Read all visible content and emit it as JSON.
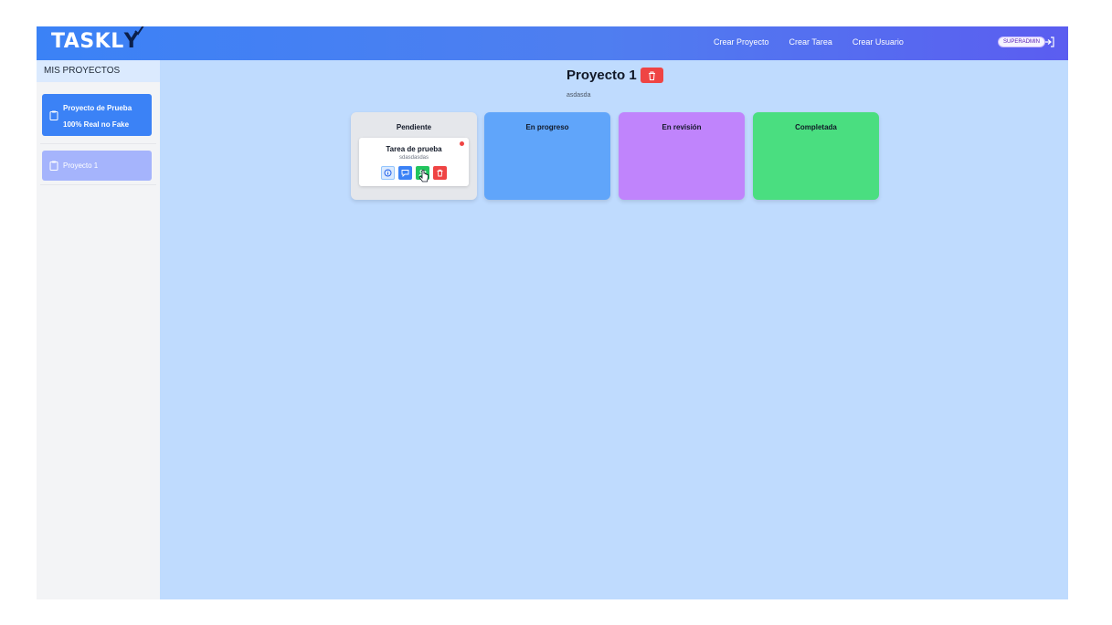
{
  "header": {
    "logo": "TASKL",
    "logo_last": "Y",
    "nav": [
      "Crear Proyecto",
      "Crear Tarea",
      "Crear Usuario"
    ],
    "role_badge": "SUPERADMIN",
    "logout_icon": "logout-icon"
  },
  "sidebar": {
    "title": "MIS PROYECTOS",
    "projects": [
      {
        "label_line1": "Proyecto de Prueba",
        "label_line2": "100% Real no Fake",
        "icon": "clipboard-icon",
        "active": true
      },
      {
        "label_line1": "Proyecto 1",
        "label_line2": "",
        "icon": "clipboard-icon",
        "active": false
      }
    ]
  },
  "main": {
    "title": "Proyecto 1",
    "description": "asdasda",
    "delete_icon": "trash-icon",
    "columns": [
      {
        "title": "Pendiente",
        "color": "#e5e7eb"
      },
      {
        "title": "En progreso",
        "color": "#60a5fa"
      },
      {
        "title": "En revisión",
        "color": "#c084fc"
      },
      {
        "title": "Completada",
        "color": "#4ade80"
      }
    ],
    "tasks": [
      {
        "title": "Tarea de prueba",
        "description": "sdasdasdas",
        "priority_color": "#ef4444",
        "actions": [
          "info-icon",
          "comment-icon",
          "assign-user-icon",
          "trash-icon"
        ]
      }
    ]
  },
  "colors": {
    "header_start": "#3b82f6",
    "header_end": "#5b5df0",
    "background": "#bfdbfe",
    "danger": "#ef4444"
  }
}
